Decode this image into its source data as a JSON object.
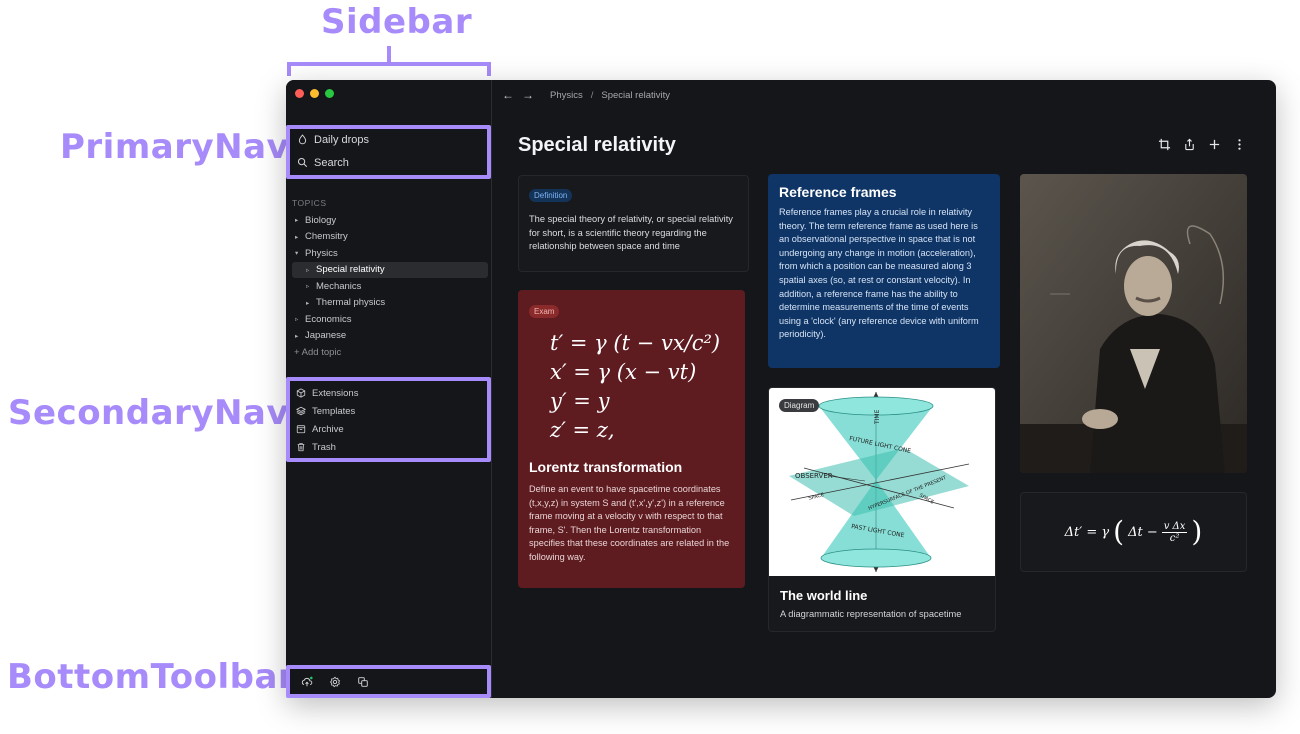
{
  "annotations": {
    "sidebar": "Sidebar",
    "primary_nav": "PrimaryNav",
    "secondary_nav": "SecondaryNav",
    "bottom_toolbar": "BottomToolbar"
  },
  "primary_nav": {
    "daily_drops": "Daily drops",
    "search": "Search"
  },
  "topics": {
    "header": "TOPICS",
    "items": [
      {
        "label": "Biology",
        "caret": "▸"
      },
      {
        "label": "Chemsitry",
        "caret": "▸"
      },
      {
        "label": "Physics",
        "caret": "▾"
      },
      {
        "label": "Special relativity",
        "caret": "▹"
      },
      {
        "label": "Mechanics",
        "caret": "▹"
      },
      {
        "label": "Thermal physics",
        "caret": "▸"
      },
      {
        "label": "Economics",
        "caret": "▹"
      },
      {
        "label": "Japanese",
        "caret": "▸"
      }
    ],
    "add_topic": "+ Add topic"
  },
  "secondary_nav": {
    "extensions": "Extensions",
    "templates": "Templates",
    "archive": "Archive",
    "trash": "Trash"
  },
  "breadcrumb": {
    "back": "←",
    "forward": "→",
    "parent": "Physics",
    "separator": "/",
    "current": "Special relativity"
  },
  "page_title": "Special relativity",
  "cards": {
    "definition": {
      "badge": "Definition",
      "body": "The special theory of relativity, or special relativity for short, is a scientific theory regarding the relationship between space and time"
    },
    "lorentz": {
      "badge": "Exam",
      "eq1": "t′ = γ (t − vx/c²)",
      "eq2": "x′ = γ (x − vt)",
      "eq3": "y′ = y",
      "eq4": "z′ = z,",
      "title": "Lorentz transformation",
      "body": "Define an event to have spacetime coordinates (t,x,y,z) in system S and (t',x',y',z') in a reference frame moving at a velocity v with respect to that frame, S'. Then the Lorentz transformation specifies that these coordinates are related in the following way."
    },
    "reference": {
      "title": "Reference frames",
      "body": "Reference frames play a crucial role in relativity theory. The term reference frame as used here is an observational perspective in space that is not undergoing any change in motion (acceleration), from which a position can be measured along 3 spatial axes (so, at rest or constant velocity). In addition, a reference frame has the ability to determine measurements of the time of events using a 'clock' (any reference device with uniform periodicity)."
    },
    "world_line": {
      "badge": "Diagram",
      "diagram_labels": {
        "time": "TIME",
        "future": "FUTURE LIGHT CONE",
        "observer": "OBSERVER",
        "hypersurface": "HYPERSURFACE OF THE PRESENT",
        "space_left": "SPACE",
        "space_right": "SPACE",
        "past": "PAST LIGHT CONE"
      },
      "title": "The world line",
      "body": "A diagrammatic representation of spacetime"
    },
    "time_dilation": {
      "lhs": "Δt′ = γ",
      "inner": "Δt −",
      "num": "v Δx",
      "den": "c²"
    }
  },
  "colors": {
    "accent": "#a78bfa",
    "definition_card": "#18191c",
    "exam_card": "#5e1b20",
    "reference_card": "#0f3566"
  }
}
